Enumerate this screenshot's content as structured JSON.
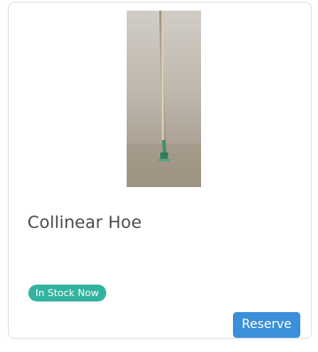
{
  "product": {
    "title": "Collinear Hoe",
    "image_icon": "hoe-product-image",
    "stock_status": "In Stock Now",
    "reserve_label": "Reserve"
  },
  "colors": {
    "badge_background": "#31b3a0",
    "button_background": "#3b8fdb",
    "title_text": "#4a4a4a"
  }
}
